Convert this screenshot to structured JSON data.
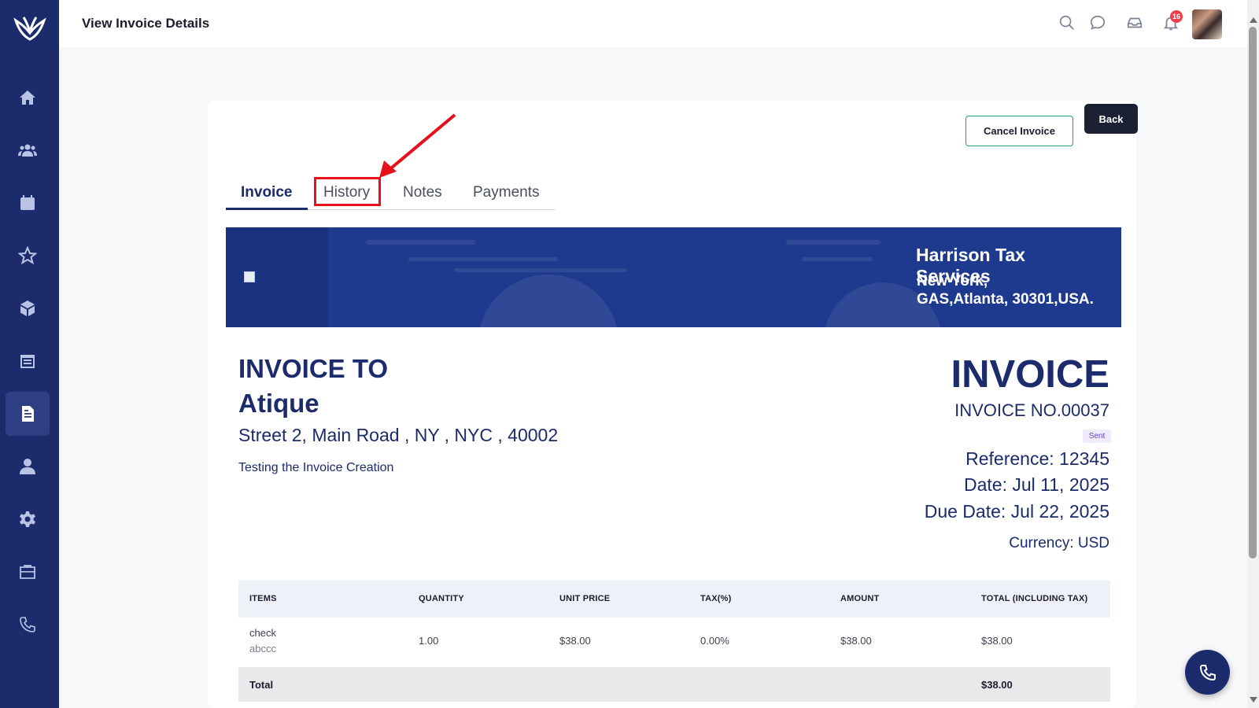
{
  "header": {
    "title": "View Invoice Details",
    "notification_count": "16"
  },
  "actions": {
    "cancel_label": "Cancel Invoice",
    "back_label": "Back"
  },
  "tabs": [
    {
      "label": "Invoice",
      "active": true
    },
    {
      "label": "History",
      "active": false
    },
    {
      "label": "Notes",
      "active": false
    },
    {
      "label": "Payments",
      "active": false
    }
  ],
  "company": {
    "name": "Harrison Tax Services",
    "address_line1": "New York,",
    "address_line2": "GAS,Atlanta, 30301,USA."
  },
  "invoice_to": {
    "label": "INVOICE TO",
    "name": "Atique",
    "address": "Street 2, Main Road , NY , NYC , 40002",
    "note": "Testing the Invoice Creation"
  },
  "invoice": {
    "heading": "INVOICE",
    "number": "INVOICE NO.00037",
    "status": "Sent",
    "reference": "Reference: 12345",
    "date": "Date: Jul 11, 2025",
    "due_date": "Due Date: Jul 22, 2025",
    "currency": "Currency: USD"
  },
  "table": {
    "headers": [
      "ITEMS",
      "QUANTITY",
      "UNIT PRICE",
      "TAX(%)",
      "AMOUNT",
      "TOTAL (INCLUDING TAX)"
    ],
    "rows": [
      {
        "item": "check",
        "description": "abccc",
        "quantity": "1.00",
        "unit_price": "$38.00",
        "tax": "0.00%",
        "amount": "$38.00",
        "total": "$38.00"
      }
    ],
    "total_label": "Total",
    "total_value": "$38.00"
  },
  "colors": {
    "primary": "#1b2b6b",
    "sidebar": "#1b2b6b",
    "highlight": "#e8101a",
    "cancel_border": "#2e9e6a"
  },
  "sidebar_icons": [
    "home-icon",
    "users-icon",
    "calendar-icon",
    "star-icon",
    "box-icon",
    "list-calendar-icon",
    "invoice-icon",
    "person-icon",
    "gear-icon",
    "briefcase-icon",
    "phone-icon"
  ]
}
